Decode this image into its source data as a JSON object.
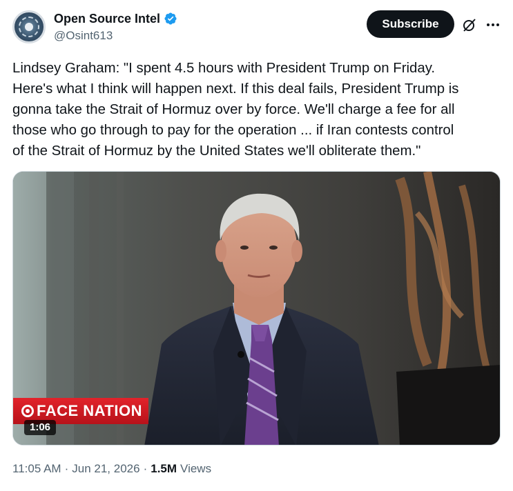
{
  "author": {
    "display_name": "Open Source Intel",
    "handle": "@Osint613",
    "verified": true,
    "avatar_icon": "osint-globe-logo"
  },
  "actions": {
    "subscribe_label": "Subscribe",
    "grok_icon": "grok-icon",
    "more_icon": "more-icon"
  },
  "tweet": {
    "text": "Lindsey Graham: \"I spent 4.5 hours with President Trump on Friday.\nHere's what I think will happen next. If this deal fails, President Trump is\ngonna take the Strait of Hormuz over by force. We'll charge a fee for all\nthose who go through to pay for the operation ... if Iran contests control\nof the Strait of Hormuz by the United States we'll obliterate them.\""
  },
  "media": {
    "type": "video",
    "duration": "1:06",
    "watermark": "FACE NATION",
    "watermark_prefix": "CBS",
    "bug_color": "#d01c23"
  },
  "meta": {
    "time": "11:05 AM",
    "separator": "·",
    "date": "Jun 21, 2026",
    "views_count": "1.5M",
    "views_label": "Views"
  },
  "colors": {
    "text": "#0f1419",
    "secondary": "#536471",
    "verified_blue": "#1d9bf0",
    "button_bg": "#0f1419"
  }
}
